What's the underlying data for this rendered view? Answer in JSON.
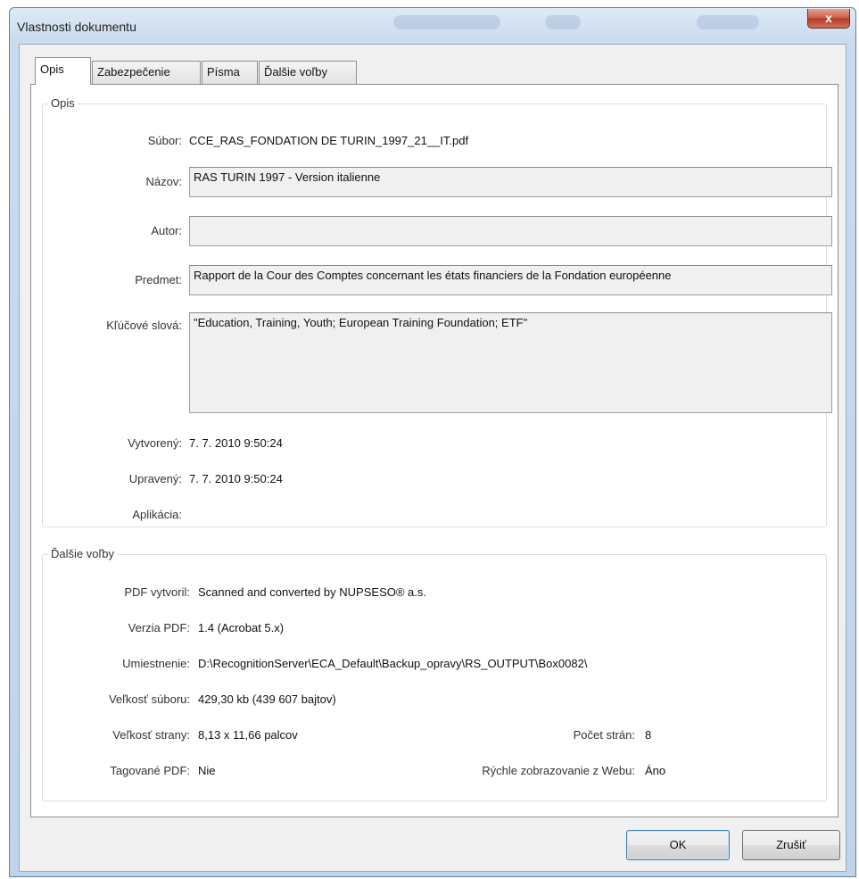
{
  "window": {
    "title": "Vlastnosti dokumentu",
    "close_glyph": "x"
  },
  "tabs": [
    {
      "label": "Opis",
      "active": true
    },
    {
      "label": "Zabezpečenie",
      "active": false
    },
    {
      "label": "Písma",
      "active": false
    },
    {
      "label": "Ďalšie voľby",
      "active": false
    }
  ],
  "opis": {
    "group_title": "Opis",
    "subor_label": "Súbor:",
    "subor_value": "CCE_RAS_FONDATION DE TURIN_1997_21__IT.pdf",
    "nazov_label": "Názov:",
    "nazov_value": "RAS TURIN 1997 - Version italienne",
    "autor_label": "Autor:",
    "autor_value": "",
    "predmet_label": "Predmet:",
    "predmet_value": "Rapport de la Cour des Comptes concernant les états  financiers de la Fondation européenne",
    "klucove_label": "Kľúčové slová:",
    "klucove_value": "\"Education, Training, Youth; European Training Foundation; ETF\"",
    "vytvoreny_label": "Vytvorený:",
    "vytvoreny_value": "7. 7. 2010 9:50:24",
    "upraveny_label": "Upravený:",
    "upraveny_value": "7. 7. 2010 9:50:24",
    "aplikacia_label": "Aplikácia:",
    "aplikacia_value": ""
  },
  "dalsie": {
    "group_title": "Ďalšie voľby",
    "pdf_vytvoril_label": "PDF vytvoril:",
    "pdf_vytvoril_value": "Scanned and converted by NUPSESO® a.s.",
    "verzia_label": "Verzia PDF:",
    "verzia_value": "1.4 (Acrobat 5.x)",
    "umiestnenie_label": "Umiestnenie:",
    "umiestnenie_value": "D:\\RecognitionServer\\ECA_Default\\Backup_opravy\\RS_OUTPUT\\Box0082\\",
    "velkost_suboru_label": "Veľkosť súboru:",
    "velkost_suboru_value": "429,30 kb (439 607 bajtov)",
    "velkost_strany_label": "Veľkosť strany:",
    "velkost_strany_value": "8,13 x 11,66 palcov",
    "pocet_stran_label": "Počet strán:",
    "pocet_stran_value": "8",
    "tagovane_label": "Tagované PDF:",
    "tagovane_value": "Nie",
    "rychle_label": "Rýchle zobrazovanie z Webu:",
    "rychle_value": "Áno"
  },
  "buttons": {
    "ok": "OK",
    "cancel": "Zrušiť"
  }
}
